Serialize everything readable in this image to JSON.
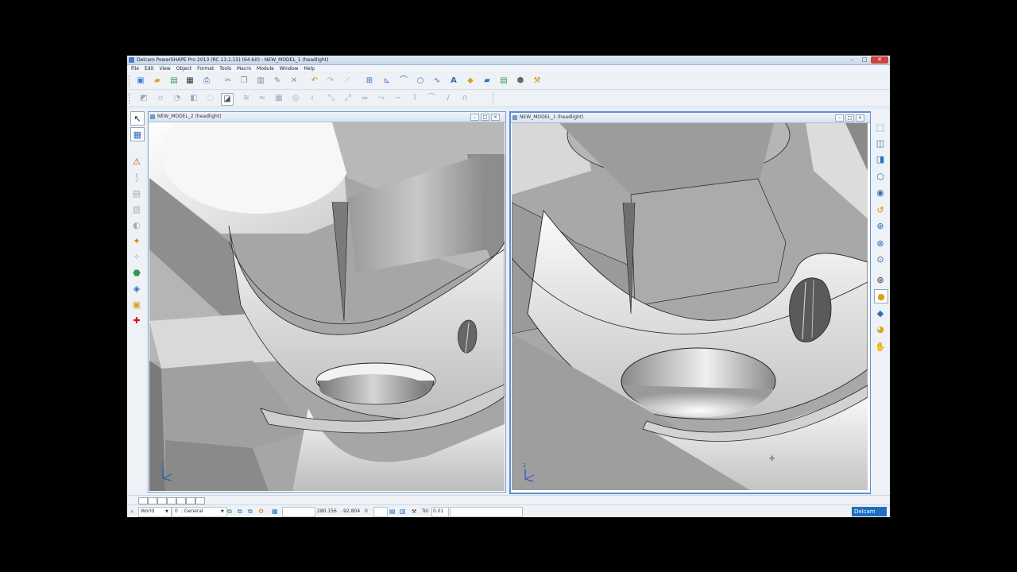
{
  "window": {
    "title": "Delcam PowerSHAPE Pro 2013 (RC 13.1.15) (64-bit) - NEW_MODEL_1 (headlight)",
    "controls": [
      "–",
      "□",
      "✕"
    ]
  },
  "menu": [
    "File",
    "Edit",
    "View",
    "Object",
    "Format",
    "Tools",
    "Macro",
    "Module",
    "Window",
    "Help"
  ],
  "toolbar_main": {
    "icons": [
      "new-model-icon",
      "open-icon",
      "open-folder-icon",
      "import-icon",
      "save-icon",
      "print-icon",
      "cut-icon",
      "copy-icon",
      "paste-icon",
      "edit-icon",
      "delete-icon",
      "undo-icon",
      "redo-icon",
      "line-icon",
      "grid-icon",
      "workplane-icon",
      "arc-icon",
      "curve-icon",
      "circle-icon",
      "text-icon",
      "dimension-icon",
      "solid-icon",
      "surface-icon",
      "assembly-icon",
      "tools-icon"
    ]
  },
  "toolbar_secondary": {
    "icons": [
      "surface-wizard-icon",
      "cylinder-icon",
      "fillet-icon",
      "extrude-icon",
      "revolve-icon",
      "active-surface-icon",
      "sweep-icon",
      "drive-curve-icon",
      "blend-icon",
      "morph-icon",
      "trim-icon",
      "split-icon",
      "join-icon",
      "offset-icon",
      "project-icon",
      "wrap-icon",
      "region-icon",
      "boundary-icon"
    ]
  },
  "left_tools": [
    "select-icon",
    "view-icon",
    "warning-icon",
    "curve-tool-icon",
    "surface-tool-icon",
    "solid-tool-icon",
    "analysis-icon",
    "fillet-tool-icon",
    "electrode-icon",
    "mold-icon",
    "drafting-icon",
    "add-icon"
  ],
  "right_tools": [
    "view-top-icon",
    "view-front-icon",
    "view-side-icon",
    "view-iso-icon",
    "camera-icon",
    "zoom-prev-icon",
    "zoom-icon",
    "zoom-fit-icon",
    "zoom-window-icon",
    "wireframe-icon",
    "shaded-icon",
    "plane-icon",
    "sphere-icon",
    "light-icon"
  ],
  "viewports": {
    "left": {
      "title": "NEW_MODEL_2 (headlight)",
      "axis_label": "Z"
    },
    "right": {
      "title": "NEW_MODEL_1 (headlight)",
      "axis_label": "Z"
    }
  },
  "status": {
    "workplane": "World",
    "level_number": "0",
    "level_name": ": General",
    "coord_x": "280.156",
    "coord_y": "-92.804",
    "coord_z": "0",
    "tol_label": "Tol",
    "tol_value": "0.01",
    "brand": "Delcam"
  }
}
